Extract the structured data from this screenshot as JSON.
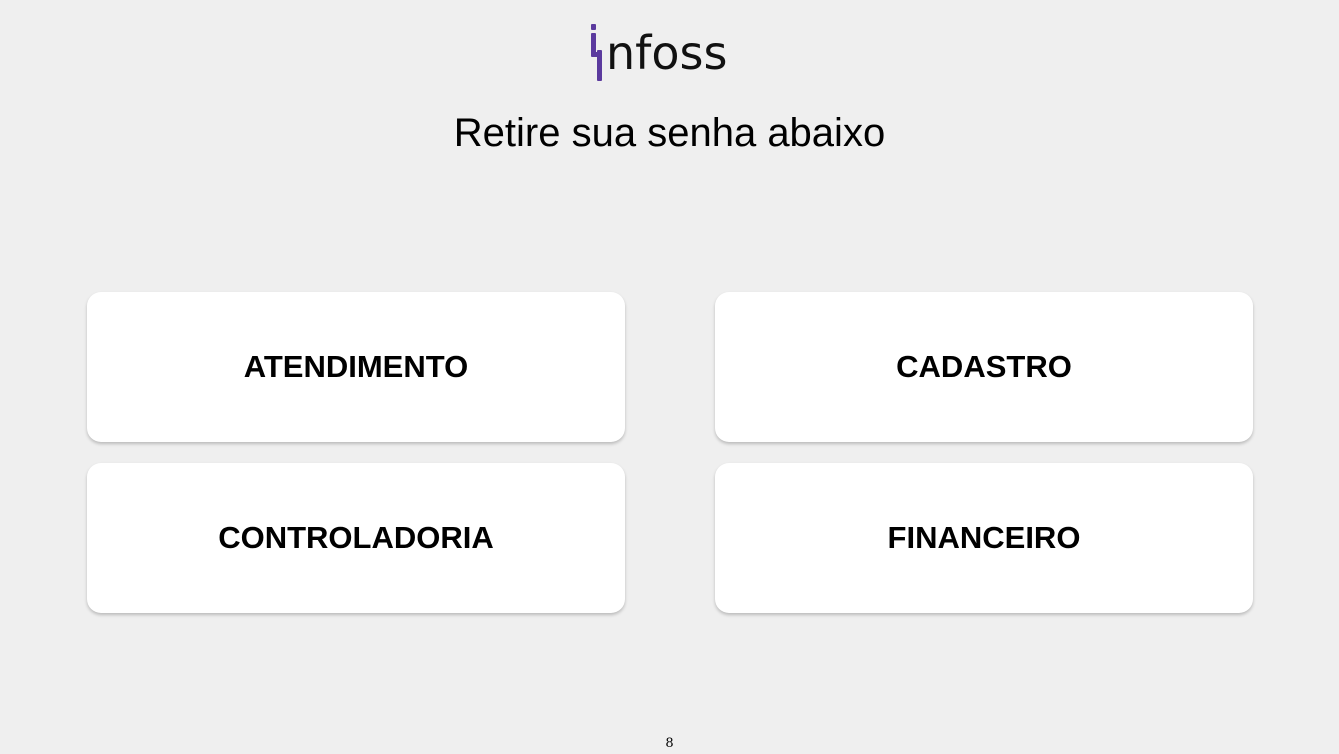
{
  "logo": {
    "text": "nfoss",
    "accent_color": "#5b3a9e"
  },
  "subtitle": "Retire sua senha abaixo",
  "buttons": [
    {
      "label": "ATENDIMENTO"
    },
    {
      "label": "CADASTRO"
    },
    {
      "label": "CONTROLADORIA"
    },
    {
      "label": "FINANCEIRO"
    }
  ],
  "footer": {
    "number": "8"
  }
}
